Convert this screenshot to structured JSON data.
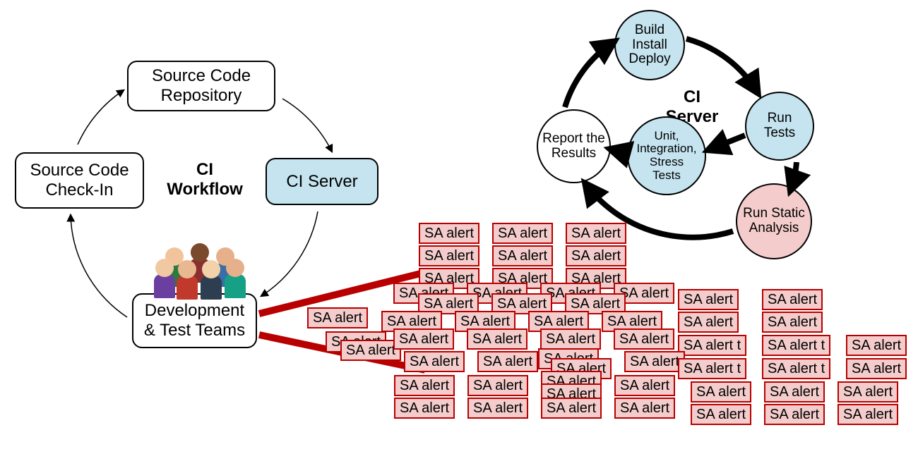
{
  "workflow": {
    "title": "CI\nWorkflow",
    "nodes": {
      "repo": "Source Code\nRepository",
      "checkin": "Source Code\nCheck-In",
      "ciserver": "CI Server",
      "teams": "Development\n& Test Teams"
    }
  },
  "server_cycle": {
    "title": "CI\nServer",
    "nodes": {
      "build": "Build\nInstall\nDeploy",
      "run_tests": "Run\nTests",
      "unit": "Unit,\nIntegration,\nStress\nTests",
      "static": "Run Static\nAnalysis",
      "report": "Report the\nResults"
    }
  },
  "alert_label": "SA alert",
  "alert_label_t": "SA alert t",
  "colors": {
    "node_blue": "#c5e4ef",
    "alert_border": "#b90000",
    "alert_fill": "#f3cccb",
    "circle_pink": "#f3cccb"
  }
}
